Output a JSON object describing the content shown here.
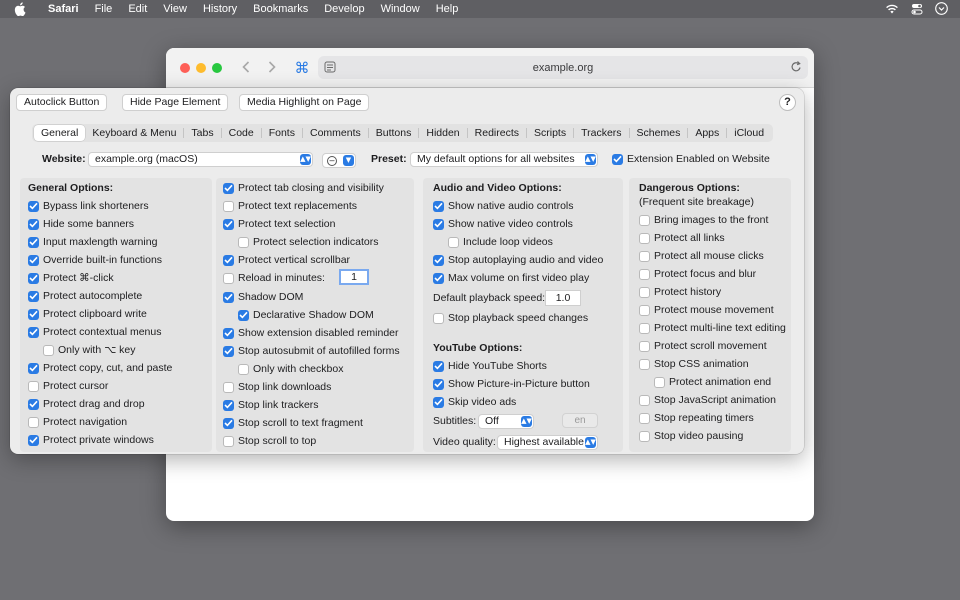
{
  "menubar": {
    "app": "Safari",
    "items": [
      "File",
      "Edit",
      "View",
      "History",
      "Bookmarks",
      "Develop",
      "Window",
      "Help"
    ],
    "status_icons": [
      "wifi-icon",
      "control-center-icon",
      "user-icon"
    ]
  },
  "browser": {
    "address": "example.org",
    "extension_icon": "⌘"
  },
  "panel": {
    "top_buttons": [
      "Autoclick Button",
      "Hide Page Element",
      "Media Highlight on Page"
    ],
    "help": "?",
    "tabs": [
      "General",
      "Keyboard & Menu",
      "Tabs",
      "Code",
      "Fonts",
      "Comments",
      "Buttons",
      "Hidden",
      "Redirects",
      "Scripts",
      "Trackers",
      "Schemes",
      "Apps",
      "iCloud"
    ],
    "active_tab": "General",
    "website_label": "Website:",
    "website_value": "example.org (macOS)",
    "preset_label": "Preset:",
    "preset_value": "My default options for all websites",
    "extension_enabled_label": "Extension Enabled on Website",
    "extension_enabled": true
  },
  "general": {
    "title": "General Options:",
    "items": [
      {
        "label": "Bypass link shorteners",
        "checked": true,
        "indent": 0
      },
      {
        "label": "Hide some banners",
        "checked": true,
        "indent": 0
      },
      {
        "label": "Input maxlength warning",
        "checked": true,
        "indent": 0
      },
      {
        "label": "Override built-in functions",
        "checked": true,
        "indent": 0
      },
      {
        "label": "Protect ⌘-click",
        "checked": true,
        "indent": 0
      },
      {
        "label": "Protect autocomplete",
        "checked": true,
        "indent": 0
      },
      {
        "label": "Protect clipboard write",
        "checked": true,
        "indent": 0
      },
      {
        "label": "Protect contextual menus",
        "checked": true,
        "indent": 0
      },
      {
        "label": "Only with ⌥ key",
        "checked": false,
        "indent": 1
      },
      {
        "label": "Protect copy, cut, and paste",
        "checked": true,
        "indent": 0
      },
      {
        "label": "Protect cursor",
        "checked": false,
        "indent": 0
      },
      {
        "label": "Protect drag and drop",
        "checked": true,
        "indent": 0
      },
      {
        "label": "Protect navigation",
        "checked": false,
        "indent": 0
      },
      {
        "label": "Protect private windows",
        "checked": true,
        "indent": 0
      }
    ]
  },
  "protect": {
    "items": [
      {
        "label": "Protect tab closing and visibility",
        "checked": true,
        "indent": 0
      },
      {
        "label": "Protect text replacements",
        "checked": false,
        "indent": 0
      },
      {
        "label": "Protect text selection",
        "checked": true,
        "indent": 0
      },
      {
        "label": "Protect selection indicators",
        "checked": false,
        "indent": 1
      },
      {
        "label": "Protect vertical scrollbar",
        "checked": true,
        "indent": 0
      },
      {
        "label": "Reload in minutes:",
        "checked": false,
        "indent": 0
      },
      {
        "label": "Shadow DOM",
        "checked": true,
        "indent": 0
      },
      {
        "label": "Declarative Shadow DOM",
        "checked": true,
        "indent": 1
      },
      {
        "label": "Show extension disabled reminder",
        "checked": true,
        "indent": 0
      },
      {
        "label": "Stop autosubmit of autofilled forms",
        "checked": true,
        "indent": 0
      },
      {
        "label": "Only with checkbox",
        "checked": false,
        "indent": 1
      },
      {
        "label": "Stop link downloads",
        "checked": false,
        "indent": 0
      },
      {
        "label": "Stop link trackers",
        "checked": true,
        "indent": 0
      },
      {
        "label": "Stop scroll to text fragment",
        "checked": true,
        "indent": 0
      },
      {
        "label": "Stop scroll to top",
        "checked": false,
        "indent": 0
      }
    ],
    "reload_minutes": "1"
  },
  "audio_video": {
    "title": "Audio and Video Options:",
    "items": [
      {
        "label": "Show native audio controls",
        "checked": true,
        "indent": 0
      },
      {
        "label": "Show native video controls",
        "checked": true,
        "indent": 0
      },
      {
        "label": "Include loop videos",
        "checked": false,
        "indent": 1
      },
      {
        "label": "Stop autoplaying audio and video",
        "checked": true,
        "indent": 0
      },
      {
        "label": "Max volume on first video play",
        "checked": true,
        "indent": 0
      }
    ],
    "playback_speed_label": "Default playback speed:",
    "playback_speed": "1.0",
    "stop_speed_changes": {
      "label": "Stop playback speed changes",
      "checked": false
    }
  },
  "youtube": {
    "title": "YouTube Options:",
    "items": [
      {
        "label": "Hide YouTube Shorts",
        "checked": true,
        "indent": 0
      },
      {
        "label": "Show Picture-in-Picture button",
        "checked": true,
        "indent": 0
      },
      {
        "label": "Skip video ads",
        "checked": true,
        "indent": 0
      }
    ],
    "subtitles_label": "Subtitles:",
    "subtitles_value": "Off",
    "subtitles_lang": "en",
    "quality_label": "Video quality:",
    "quality_value": "Highest available"
  },
  "dangerous": {
    "title": "Dangerous Options:",
    "subtitle": "(Frequent site breakage)",
    "items": [
      {
        "label": "Bring images to the front",
        "checked": false,
        "indent": 0
      },
      {
        "label": "Protect all links",
        "checked": false,
        "indent": 0
      },
      {
        "label": "Protect all mouse clicks",
        "checked": false,
        "indent": 0
      },
      {
        "label": "Protect focus and blur",
        "checked": false,
        "indent": 0
      },
      {
        "label": "Protect history",
        "checked": false,
        "indent": 0
      },
      {
        "label": "Protect mouse movement",
        "checked": false,
        "indent": 0
      },
      {
        "label": "Protect multi-line text editing",
        "checked": false,
        "indent": 0
      },
      {
        "label": "Protect scroll movement",
        "checked": false,
        "indent": 0
      },
      {
        "label": "Stop CSS animation",
        "checked": false,
        "indent": 0
      },
      {
        "label": "Protect animation end",
        "checked": false,
        "indent": 1
      },
      {
        "label": "Stop JavaScript animation",
        "checked": false,
        "indent": 0
      },
      {
        "label": "Stop repeating timers",
        "checked": false,
        "indent": 0
      },
      {
        "label": "Stop video pausing",
        "checked": false,
        "indent": 0
      }
    ]
  },
  "colors": {
    "accent": "#2a7be4",
    "panel": "#ececec",
    "column": "#e3e3e3"
  }
}
